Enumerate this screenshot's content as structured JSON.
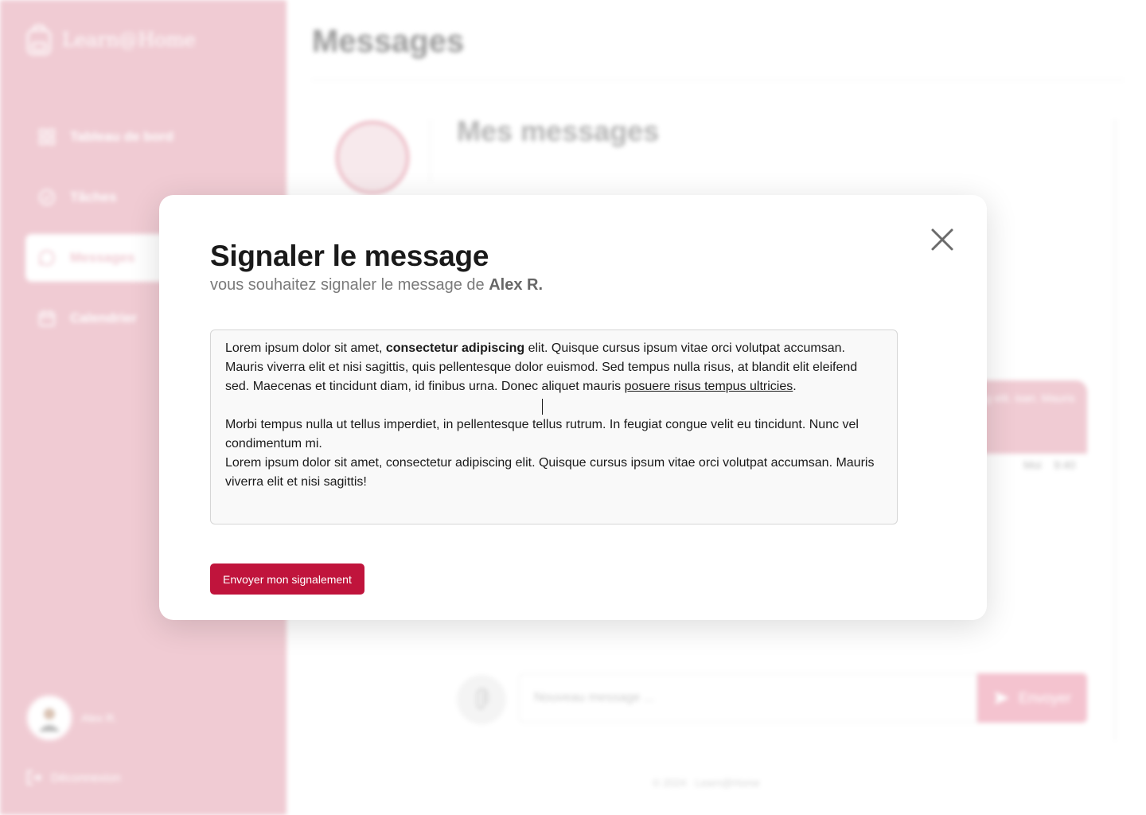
{
  "app": {
    "brand": "Learn@Home",
    "nav": [
      {
        "label": "Tableau de bord",
        "icon": "dashboard-icon"
      },
      {
        "label": "Tâches",
        "icon": "check-circle-icon"
      },
      {
        "label": "Messages",
        "icon": "chat-icon",
        "active": true
      },
      {
        "label": "Calendrier",
        "icon": "calendar-icon"
      }
    ],
    "user": {
      "name": "Alex R."
    },
    "logout_label": "Déconnexion",
    "page_title": "Messages",
    "conversation_title": "Mes messages",
    "bubble_text": "ng elit. isan. Mauris",
    "bubble_meta": {
      "sender": "Moi",
      "time": "9:40"
    },
    "composer": {
      "placeholder": "Nouveau message ...",
      "send_label": "Envoyer"
    },
    "footer": "© 2024 · Learn@Home"
  },
  "modal": {
    "title": "Signaler le message",
    "subtitle_prefix": "vous souhaitez signaler le message de ",
    "subtitle_name": "Alex R.",
    "message": {
      "p1_start": "Lorem ipsum dolor sit amet, ",
      "p1_bold": "consectetur adipiscing",
      "p1_mid": " elit. Quisque cursus ipsum vitae orci volutpat accumsan. Mauris viverra elit et nisi sagittis, quis pellentesque dolor euismod. Sed tempus nulla risus, at blandit elit eleifend sed. Maecenas et tincidunt diam, id finibus urna. Donec aliquet mauris ",
      "p1_link": "posuere risus tempus ultricies",
      "p1_end": ".",
      "p2": "Morbi tempus nulla ut tellus imperdiet, in pellentesque tellus rutrum. In feugiat congue velit eu tincidunt. Nunc vel condimentum mi.",
      "p3": "Lorem ipsum dolor sit amet, consectetur adipiscing elit. Quisque cursus ipsum vitae orci volutpat accumsan. Mauris viverra elit et nisi sagittis!"
    },
    "submit_label": "Envoyer mon signalement",
    "colors": {
      "accent": "#c0143c",
      "sidebar": "#f0cbd3"
    }
  }
}
